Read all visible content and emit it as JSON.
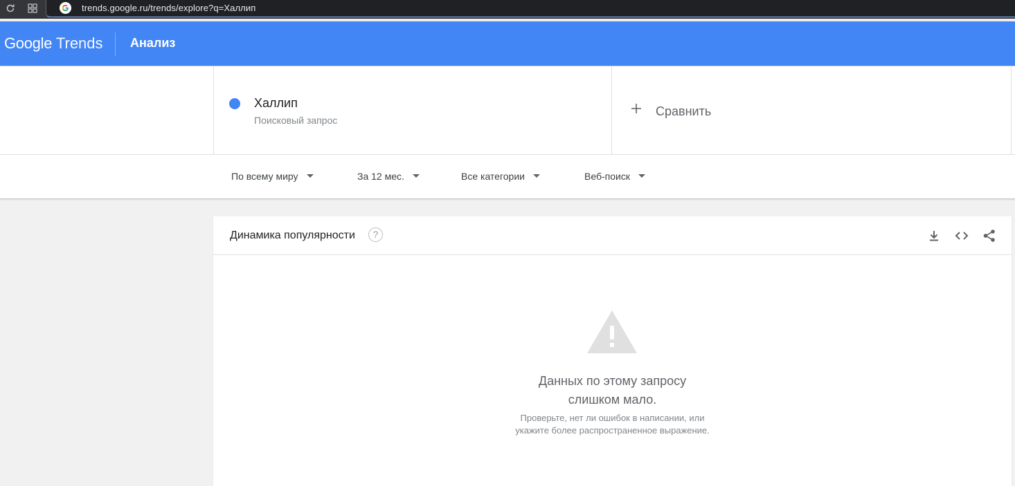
{
  "browser": {
    "url": "trends.google.ru/trends/explore?q=Халлип",
    "reload_icon": "reload-icon",
    "apps_icon": "apps-grid-icon",
    "site_icon": "google-g-icon"
  },
  "header": {
    "logo_google": "Google",
    "logo_trends": "Trends",
    "title": "Анализ",
    "color": "#4285f4"
  },
  "terms": {
    "term": {
      "name": "Халлип",
      "type": "Поисковый запрос",
      "color": "#4285f4"
    },
    "compare_label": "Сравнить",
    "compare_icon": "plus-icon"
  },
  "filters": [
    {
      "label": "По всему миру"
    },
    {
      "label": "За 12 мес."
    },
    {
      "label": "Все категории"
    },
    {
      "label": "Веб-поиск"
    }
  ],
  "interest_card": {
    "title": "Динамика популярности",
    "help_symbol": "?",
    "icons": [
      "download-icon",
      "embed-code-icon",
      "share-icon"
    ],
    "empty": {
      "icon": "warning-icon",
      "title_line1": "Данных по этому запросу",
      "title_line2": "слишком мало.",
      "hint_line1": "Проверьте, нет ли ошибок в написании, или",
      "hint_line2": "укажите более распространенное выражение."
    }
  }
}
